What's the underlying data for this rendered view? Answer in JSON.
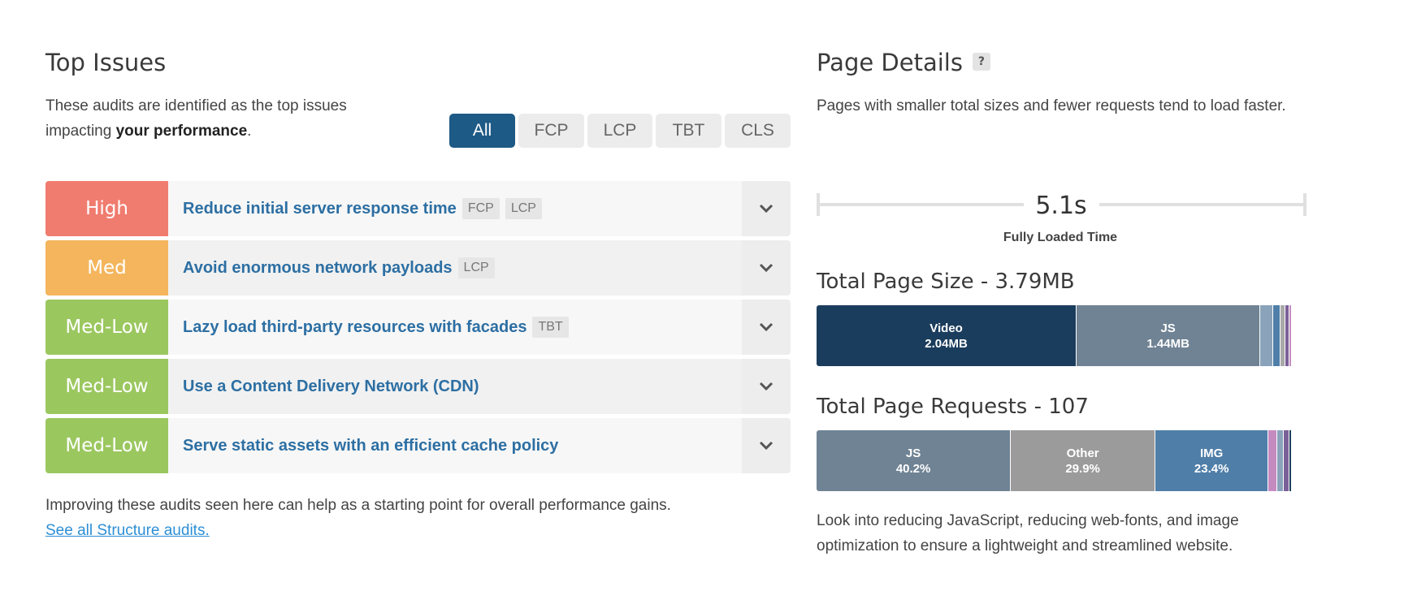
{
  "top_issues": {
    "title": "Top Issues",
    "intro_plain": "These audits are identified as the top issues impacting ",
    "intro_bold": "your performance",
    "intro_end": ".",
    "filters": [
      "All",
      "FCP",
      "LCP",
      "TBT",
      "CLS"
    ],
    "active_filter": "All",
    "issues": [
      {
        "severity": "High",
        "color": "#f07c6f",
        "title": "Reduce initial server response time",
        "tags": [
          "FCP",
          "LCP"
        ]
      },
      {
        "severity": "Med",
        "color": "#f4b55c",
        "title": "Avoid enormous network payloads",
        "tags": [
          "LCP"
        ]
      },
      {
        "severity": "Med-Low",
        "color": "#9bc75f",
        "title": "Lazy load third-party resources with facades",
        "tags": [
          "TBT"
        ]
      },
      {
        "severity": "Med-Low",
        "color": "#9bc75f",
        "title": "Use a Content Delivery Network (CDN)",
        "tags": []
      },
      {
        "severity": "Med-Low",
        "color": "#9bc75f",
        "title": "Serve static assets with an efficient cache policy",
        "tags": []
      }
    ],
    "footer_text": "Improving these audits seen here can help as a starting point for overall performance gains.",
    "footer_link": "See all Structure audits."
  },
  "page_details": {
    "title": "Page Details",
    "help_badge": "?",
    "intro": "Pages with smaller total sizes and fewer requests tend to load faster.",
    "fully_loaded_value": "5.1s",
    "fully_loaded_label": "Fully Loaded Time",
    "size_heading": "Total Page Size - 3.79MB",
    "size_segments": [
      {
        "label": "Video",
        "value": "2.04MB",
        "share": 0.538,
        "color": "#1b3d5d"
      },
      {
        "label": "JS",
        "value": "1.44MB",
        "share": 0.38,
        "color": "#6f8394"
      },
      {
        "label": "",
        "value": "",
        "share": 0.026,
        "color": "#8aa3bb"
      },
      {
        "label": "",
        "value": "",
        "share": 0.016,
        "color": "#4f7ea8"
      },
      {
        "label": "",
        "value": "",
        "share": 0.01,
        "color": "#a9a9a9"
      },
      {
        "label": "",
        "value": "",
        "share": 0.008,
        "color": "#7a5f98"
      },
      {
        "label": "",
        "value": "",
        "share": 0.006,
        "color": "#c58bc0"
      }
    ],
    "requests_heading": "Total Page Requests - 107",
    "request_segments": [
      {
        "label": "JS",
        "value": "40.2%",
        "share": 0.402,
        "color": "#6f8394"
      },
      {
        "label": "Other",
        "value": "29.9%",
        "share": 0.299,
        "color": "#9b9b9b"
      },
      {
        "label": "IMG",
        "value": "23.4%",
        "share": 0.234,
        "color": "#4f7ea8"
      },
      {
        "label": "",
        "value": "",
        "share": 0.018,
        "color": "#c58bc0"
      },
      {
        "label": "",
        "value": "",
        "share": 0.013,
        "color": "#8aa3bb"
      },
      {
        "label": "",
        "value": "",
        "share": 0.012,
        "color": "#7a5f98"
      },
      {
        "label": "",
        "value": "",
        "share": 0.006,
        "color": "#1b3d5d"
      }
    ],
    "conclusion": "Look into reducing JavaScript, reducing web-fonts, and image optimization to ensure a lightweight and streamlined website."
  }
}
